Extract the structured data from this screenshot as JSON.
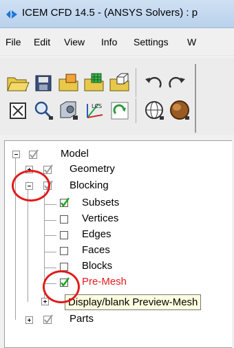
{
  "window": {
    "title": "ICEM CFD 14.5 - (ANSYS Solvers) : p"
  },
  "menu": [
    "File",
    "Edit",
    "View",
    "Info",
    "Settings",
    "W"
  ],
  "toolbar": {
    "row1": [
      "open-folder-icon",
      "save-icon",
      "geometry-open-icon",
      "mesh-open-icon",
      "blocking-open-icon",
      "undo-icon",
      "redo-icon"
    ],
    "row2": [
      "fit-window-icon",
      "zoom-box-icon",
      "display-options-icon",
      "local-coordinate-icon",
      "refresh-icon",
      "wireframe-icon",
      "solid-icon"
    ]
  },
  "tree": {
    "model": {
      "label": "Model"
    },
    "geometry": {
      "label": "Geometry"
    },
    "blocking": {
      "label": "Blocking"
    },
    "subsets": {
      "label": "Subsets",
      "checked": true
    },
    "vertices": {
      "label": "Vertices",
      "checked": false
    },
    "edges": {
      "label": "Edges",
      "checked": false
    },
    "faces": {
      "label": "Faces",
      "checked": false
    },
    "blocks": {
      "label": "Blocks",
      "checked": false
    },
    "premesh": {
      "label": "Pre-Mesh",
      "checked": true
    },
    "parts": {
      "label": "Parts"
    }
  },
  "tooltip": {
    "text": "Display/blank Preview-Mesh"
  },
  "colors": {
    "check": "#1aa61a",
    "highlight": "#e21b1b",
    "tooltip_bg": "#ffffe1"
  }
}
